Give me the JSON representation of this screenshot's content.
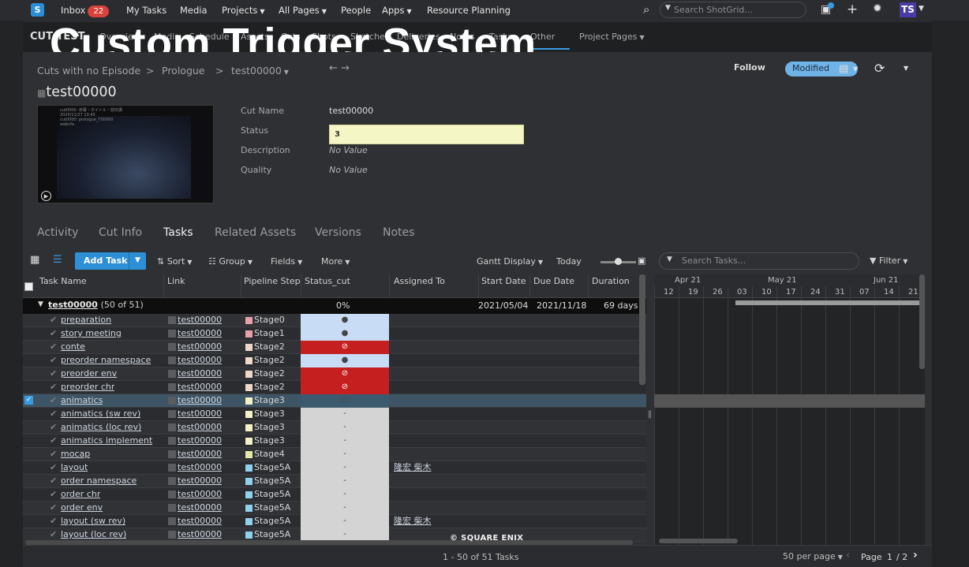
{
  "topnav": {
    "logo": "S",
    "inbox_label": "Inbox",
    "inbox_count": "22",
    "my_tasks": "My Tasks",
    "media": "Media",
    "projects": "Projects",
    "all_pages": "All Pages",
    "people": "People",
    "apps": "Apps",
    "resource_planning": "Resource Planning",
    "search_placeholder": "Search ShotGrid...",
    "avatar_initials": "TS"
  },
  "project_bar": {
    "name": "CUT TEST",
    "tabs": [
      "Overview",
      "Media",
      "Schedule",
      "Assets",
      "Cuts",
      "Shots",
      "Sketches",
      "Deliveries",
      "Notes",
      "Tasks",
      "Other",
      "Project Pages"
    ]
  },
  "overlay_title": "Custom Trigger System",
  "breadcrumb": {
    "items": [
      "Cuts with no Episode",
      "Prologue",
      "test00000"
    ],
    "sep": ">"
  },
  "header_actions": {
    "follow": "Follow",
    "modified": "Modified"
  },
  "entity": {
    "title": "test00000",
    "thumb_caption": "cut0000: 序幕・タイトル・前日譚\n2020/11/27 10:45\ncut0000: prologue_T00000\nwebcfa",
    "fields": [
      {
        "label": "Cut Name",
        "value": "test00000"
      },
      {
        "label": "Status",
        "value": "3"
      },
      {
        "label": "Description",
        "value": "No Value"
      },
      {
        "label": "Quality",
        "value": "No Value"
      }
    ]
  },
  "detail_tabs": [
    "Activity",
    "Cut Info",
    "Tasks",
    "Related Assets",
    "Versions",
    "Notes"
  ],
  "toolbar": {
    "add_task": "Add Task",
    "sort": "Sort",
    "group": "Group",
    "fields": "Fields",
    "more": "More",
    "gantt_display": "Gantt Display",
    "today": "Today",
    "search_placeholder": "Search Tasks...",
    "filter": "Filter"
  },
  "grid": {
    "columns": [
      "Task Name",
      "Link",
      "Pipeline Step",
      "Status_cut",
      "Assigned To",
      "Start Date",
      "Due Date",
      "Duration"
    ],
    "group": {
      "name": "test00000",
      "count": "(50 of 51)",
      "status": "0%",
      "start": "2021/05/04",
      "due": "2021/11/18",
      "duration": "69 days"
    },
    "rows": [
      {
        "name": "preparation",
        "link": "test00000",
        "step": "Stage0",
        "step_color": "#e8a0a8",
        "status": "●",
        "status_bg": "#c8dcf6",
        "assigned": ""
      },
      {
        "name": "story meeting",
        "link": "test00000",
        "step": "Stage1",
        "step_color": "#e8a0a8",
        "status": "●",
        "status_bg": "#c8dcf6",
        "assigned": ""
      },
      {
        "name": "conte",
        "link": "test00000",
        "step": "Stage2",
        "step_color": "#f0d8c8",
        "status": "⊘",
        "status_bg": "#c61f1f",
        "assigned": ""
      },
      {
        "name": "preorder namespace",
        "link": "test00000",
        "step": "Stage2",
        "step_color": "#f0d8c8",
        "status": "●",
        "status_bg": "#c8dcf6",
        "assigned": ""
      },
      {
        "name": "preorder env",
        "link": "test00000",
        "step": "Stage2",
        "step_color": "#f0d8c8",
        "status": "⊘",
        "status_bg": "#c61f1f",
        "assigned": ""
      },
      {
        "name": "preorder chr",
        "link": "test00000",
        "step": "Stage2",
        "step_color": "#f0d8c8",
        "status": "⊘",
        "status_bg": "#c61f1f",
        "assigned": ""
      },
      {
        "name": "animatics",
        "link": "test00000",
        "step": "Stage3",
        "step_color": "#f4f0c8",
        "status": "○",
        "status_bg": "#3c5a6e",
        "assigned": "",
        "selected": true
      },
      {
        "name": "animatics (sw rev)",
        "link": "test00000",
        "step": "Stage3",
        "step_color": "#f4f0c8",
        "status": "-",
        "status_bg": "#d4d4d4",
        "assigned": ""
      },
      {
        "name": "animatics (loc rev)",
        "link": "test00000",
        "step": "Stage3",
        "step_color": "#f4f0c8",
        "status": "-",
        "status_bg": "#d4d4d4",
        "assigned": ""
      },
      {
        "name": "animatics implement",
        "link": "test00000",
        "step": "Stage3",
        "step_color": "#f4f0c8",
        "status": "-",
        "status_bg": "#d4d4d4",
        "assigned": ""
      },
      {
        "name": "mocap",
        "link": "test00000",
        "step": "Stage4",
        "step_color": "#e6e8a8",
        "status": "-",
        "status_bg": "#d4d4d4",
        "assigned": ""
      },
      {
        "name": "layout",
        "link": "test00000",
        "step": "Stage5A",
        "step_color": "#8fd0ec",
        "status": "-",
        "status_bg": "#d4d4d4",
        "assigned": "隆宏 柴木"
      },
      {
        "name": "order namespace",
        "link": "test00000",
        "step": "Stage5A",
        "step_color": "#8fd0ec",
        "status": "-",
        "status_bg": "#d4d4d4",
        "assigned": ""
      },
      {
        "name": "order chr",
        "link": "test00000",
        "step": "Stage5A",
        "step_color": "#8fd0ec",
        "status": "-",
        "status_bg": "#d4d4d4",
        "assigned": ""
      },
      {
        "name": "order env",
        "link": "test00000",
        "step": "Stage5A",
        "step_color": "#8fd0ec",
        "status": "-",
        "status_bg": "#d4d4d4",
        "assigned": ""
      },
      {
        "name": "layout (sw rev)",
        "link": "test00000",
        "step": "Stage5A",
        "step_color": "#8fd0ec",
        "status": "-",
        "status_bg": "#d4d4d4",
        "assigned": "隆宏 柴木"
      },
      {
        "name": "layout (loc rev)",
        "link": "test00000",
        "step": "Stage5A",
        "step_color": "#8fd0ec",
        "status": "-",
        "status_bg": "#d4d4d4",
        "assigned": ""
      }
    ]
  },
  "gantt": {
    "months": [
      "Apr 21",
      "May 21",
      "Jun 21"
    ],
    "days": [
      "12",
      "19",
      "26",
      "03",
      "10",
      "17",
      "24",
      "31",
      "07",
      "14",
      "21"
    ]
  },
  "footer": {
    "range": "1 - 50 of 51 Tasks",
    "per_page": "50 per page",
    "page_label": "Page",
    "page_num": "1",
    "page_total": "/ 2"
  },
  "watermark": "© SQUARE ENIX"
}
